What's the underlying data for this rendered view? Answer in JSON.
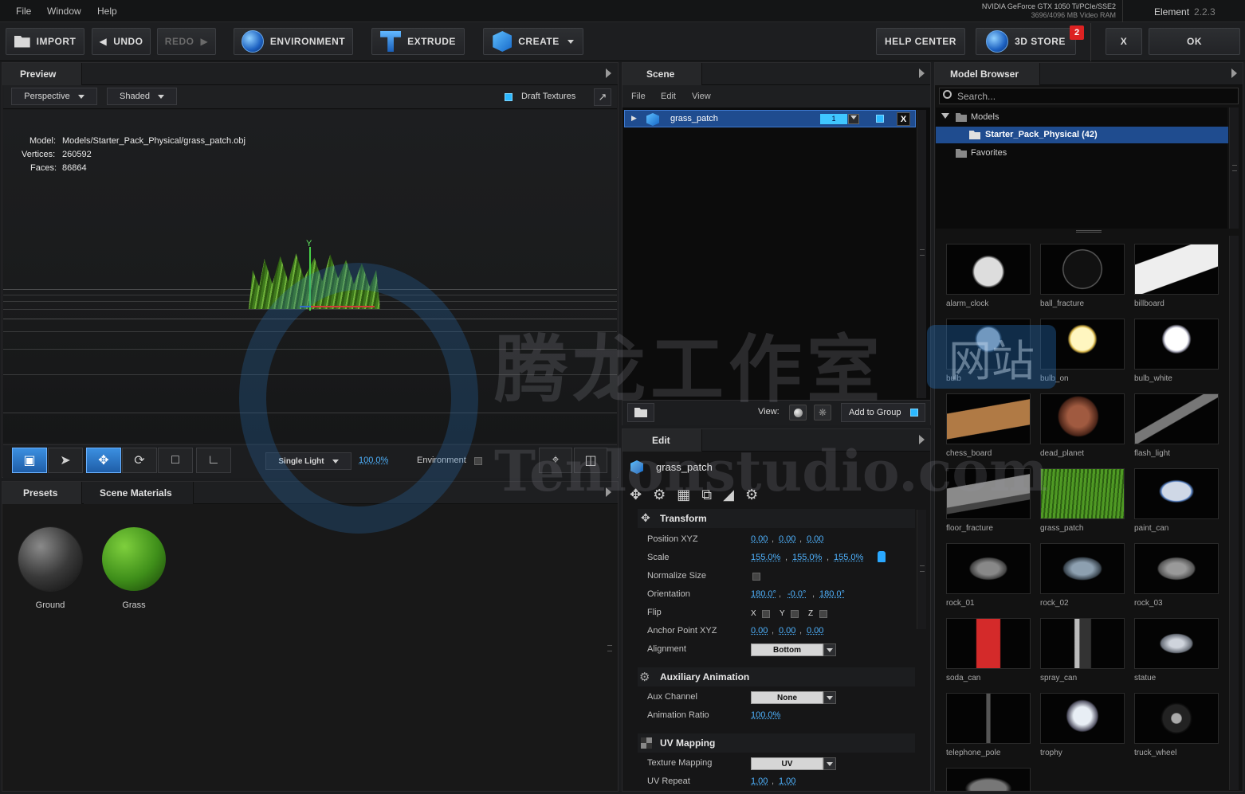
{
  "menubar": {
    "items": [
      "File",
      "Window",
      "Help"
    ],
    "gpu": "NVIDIA GeForce GTX 1050 Ti/PCIe/SSE2",
    "vram": "3696/4096 MB Video RAM",
    "app_name": "Element",
    "version": "2.2.3"
  },
  "toolbar": {
    "import": "IMPORT",
    "undo": "UNDO",
    "redo": "REDO",
    "environment": "ENVIRONMENT",
    "extrude": "EXTRUDE",
    "create": "CREATE",
    "help_center": "HELP CENTER",
    "store": "3D STORE",
    "store_badge": "2",
    "close": "X",
    "ok": "OK"
  },
  "preview": {
    "tab": "Preview",
    "projection": "Perspective",
    "shading": "Shaded",
    "draft_textures": "Draft Textures",
    "model_label": "Model:",
    "model_path": "Models/Starter_Pack_Physical/grass_patch.obj",
    "vertices_label": "Vertices:",
    "vertices": "260592",
    "faces_label": "Faces:",
    "faces": "86864",
    "axis_y": "Y",
    "light": "Single Light",
    "light_pct": "100.0%",
    "environment": "Environment"
  },
  "materials": {
    "tab_presets": "Presets",
    "tab_scene": "Scene Materials",
    "items": [
      "Ground",
      "Grass"
    ]
  },
  "scene": {
    "tab": "Scene",
    "menu": [
      "File",
      "Edit",
      "View"
    ],
    "row_name": "grass_patch",
    "row_num": "1",
    "view_label": "View:",
    "add_to_group": "Add to Group"
  },
  "edit": {
    "tab": "Edit",
    "object_name": "grass_patch",
    "transform": "Transform",
    "position_label": "Position XYZ",
    "position": [
      "0.00",
      "0.00",
      "0.00"
    ],
    "scale_label": "Scale",
    "scale": [
      "155.0%",
      "155.0%",
      "155.0%"
    ],
    "normalize_label": "Normalize Size",
    "orientation_label": "Orientation",
    "orientation": [
      "180.0°",
      "-0.0°",
      "180.0°"
    ],
    "flip_label": "Flip",
    "flip_x": "X",
    "flip_y": "Y",
    "flip_z": "Z",
    "anchor_label": "Anchor Point XYZ",
    "anchor": [
      "0.00",
      "0.00",
      "0.00"
    ],
    "alignment_label": "Alignment",
    "alignment": "Bottom",
    "aux_section": "Auxiliary Animation",
    "aux_channel_label": "Aux Channel",
    "aux_channel": "None",
    "anim_ratio_label": "Animation Ratio",
    "anim_ratio": "100.0%",
    "uv_section": "UV Mapping",
    "tex_map_label": "Texture Mapping",
    "tex_map": "UV",
    "uv_repeat_label": "UV Repeat",
    "uv_repeat": [
      "1.00",
      "1.00"
    ]
  },
  "browser": {
    "tab": "Model Browser",
    "search_placeholder": "Search...",
    "tree": {
      "root": "Models",
      "selected": "Starter_Pack_Physical (42)",
      "favorites": "Favorites"
    },
    "models": [
      "alarm_clock",
      "ball_fracture",
      "billboard",
      "bulb",
      "bulb_on",
      "bulb_white",
      "chess_board",
      "dead_planet",
      "flash_light",
      "floor_fracture",
      "grass_patch",
      "paint_can",
      "rock_01",
      "rock_02",
      "rock_03",
      "soda_can",
      "spray_can",
      "statue",
      "telephone_pole",
      "trophy",
      "truck_wheel"
    ]
  },
  "watermark": {
    "cn": "腾龙工作室",
    "badge": "网站",
    "en": "Tenlonstudio.com"
  }
}
